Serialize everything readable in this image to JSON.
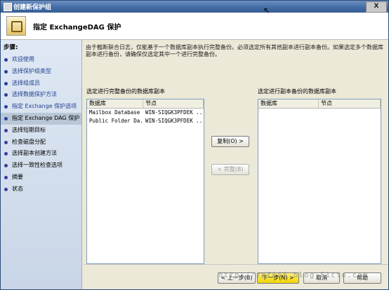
{
  "window": {
    "title": "创建新保护组",
    "close_glyph": "X"
  },
  "header": {
    "title": "指定 ExchangeDAG 保护",
    "icon": "protection-group-icon"
  },
  "sidebar": {
    "heading": "步骤:",
    "steps": [
      {
        "label": "欢迎使用",
        "state": "done"
      },
      {
        "label": "选择保护组类型",
        "state": "done"
      },
      {
        "label": "选择组成员",
        "state": "done"
      },
      {
        "label": "选择数据保护方法",
        "state": "done"
      },
      {
        "label": "指定 Exchange 保护选项",
        "state": "done"
      },
      {
        "label": "指定 Exchange DAG 保护",
        "state": "current"
      },
      {
        "label": "选择短期目标",
        "state": "todo"
      },
      {
        "label": "检查磁盘分配",
        "state": "todo"
      },
      {
        "label": "选择副本创建方法",
        "state": "todo"
      },
      {
        "label": "选择一致性检查选项",
        "state": "todo"
      },
      {
        "label": "摘要",
        "state": "todo"
      },
      {
        "label": "状态",
        "state": "todo"
      }
    ]
  },
  "main": {
    "description": "由于截断联合日志，仅能基于一个数据库副本执行完整备份。必须选定所有其他副本进行副本备份。如果选定多个数据库副本进行备份，请确保仅选定其中一个进行完整备份。",
    "full_backup_label": "选定进行完整备份的数据库副本",
    "copy_backup_label": "选定进行副本备份的数据库副本",
    "columns": [
      "数据库",
      "节点"
    ],
    "full_backup_rows": [
      {
        "database": "Mailbox Database ...",
        "node": "WIN-SIQGK3PFDEK ..."
      },
      {
        "database": "Public Folder Da...",
        "node": "WIN-SIQGK3PFDEK ..."
      }
    ],
    "copy_backup_rows": []
  },
  "buttons": {
    "copy": "复制(O) >",
    "full_backup": "< 完整(B)",
    "back": "< 上一步(B)",
    "next": "下一步(N) >",
    "cancel": "取消",
    "help": "帮助"
  },
  "watermark": "http://zpf666.blog.51cto.com"
}
